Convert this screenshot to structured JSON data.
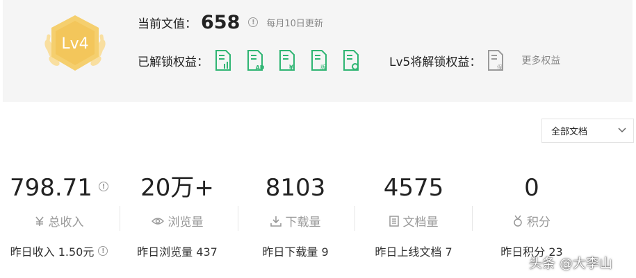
{
  "level": {
    "badge_text": "Lv4",
    "colors": {
      "badge": "#f5cf6e",
      "wreath": "#f9dfa0",
      "rights_green": "#2fb573",
      "locked_gray": "#9a9a9a"
    }
  },
  "header": {
    "score_label": "当前文值：",
    "score_value": "658",
    "update_note": "每月10日更新",
    "unlocked_label": "已解锁权益：",
    "unlocked_rights": [
      {
        "icon": "doc-chart-icon",
        "tag": ""
      },
      {
        "icon": "doc-ad-icon",
        "tag": "AD"
      },
      {
        "icon": "doc-yen-icon",
        "tag": "¥"
      },
      {
        "icon": "doc-copyright-icon",
        "tag": "版"
      },
      {
        "icon": "doc-refresh-icon",
        "tag": ""
      }
    ],
    "next_label": "Lv5将解锁权益：",
    "next_right": {
      "icon": "doc-protect-icon",
      "tag": "保"
    },
    "more_link": "更多权益"
  },
  "filter": {
    "selected": "全部文档"
  },
  "stats": [
    {
      "value": "798.71",
      "label": "总收入",
      "icon": "yen-icon",
      "sub": "昨日收入 1.50元",
      "value_info": true,
      "sub_info": true
    },
    {
      "value": "20万+",
      "label": "浏览量",
      "icon": "eye-icon",
      "sub": "昨日浏览量 437"
    },
    {
      "value": "8103",
      "label": "下载量",
      "icon": "download-icon",
      "sub": "昨日下载量 9"
    },
    {
      "value": "4575",
      "label": "文档量",
      "icon": "document-icon",
      "sub": "昨日上线文档 7"
    },
    {
      "value": "0",
      "label": "积分",
      "icon": "medal-icon",
      "sub": "昨日积分 23"
    }
  ],
  "watermark": "头条 @大李山"
}
